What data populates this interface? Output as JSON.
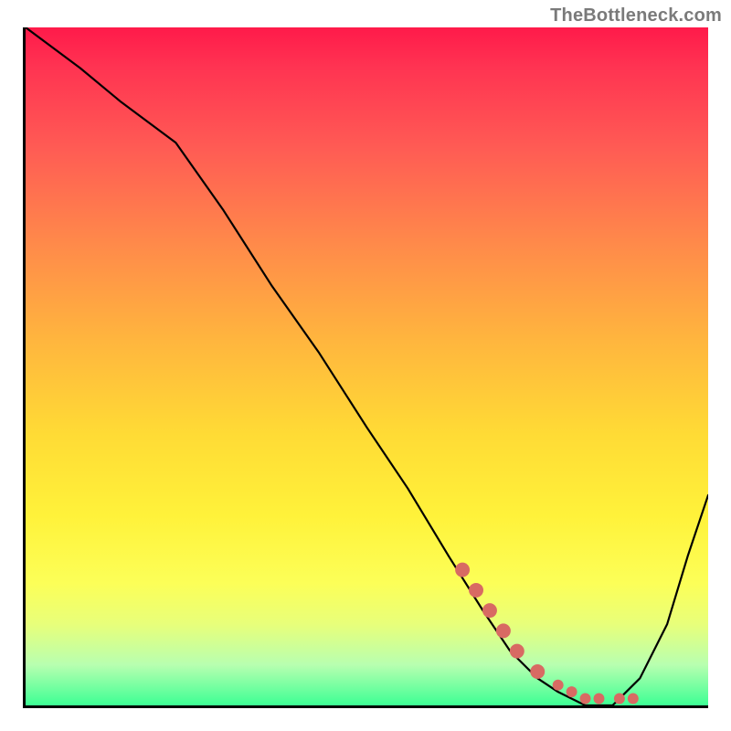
{
  "attribution": "TheBottleneck.com",
  "chart_data": {
    "type": "line",
    "title": "",
    "xlabel": "",
    "ylabel": "",
    "xlim": [
      0,
      100
    ],
    "ylim": [
      0,
      100
    ],
    "x": [
      0,
      8,
      14,
      22,
      29,
      36,
      43,
      50,
      56,
      62,
      67,
      71,
      75,
      78,
      82,
      86,
      90,
      94,
      97,
      100
    ],
    "values": [
      100,
      94,
      89,
      83,
      73,
      62,
      52,
      41,
      32,
      22,
      14,
      8,
      4,
      2,
      0,
      0,
      4,
      12,
      22,
      31
    ],
    "scatter": {
      "x": [
        64,
        66,
        68,
        70,
        72,
        75,
        78,
        80,
        82,
        84,
        87,
        89
      ],
      "values": [
        20,
        17,
        14,
        11,
        8,
        5,
        3,
        2,
        1,
        1,
        1,
        1
      ]
    },
    "gradient_colors": [
      "#ff1a4a",
      "#ff5c54",
      "#ffb53e",
      "#fff23a",
      "#3dff94"
    ]
  }
}
